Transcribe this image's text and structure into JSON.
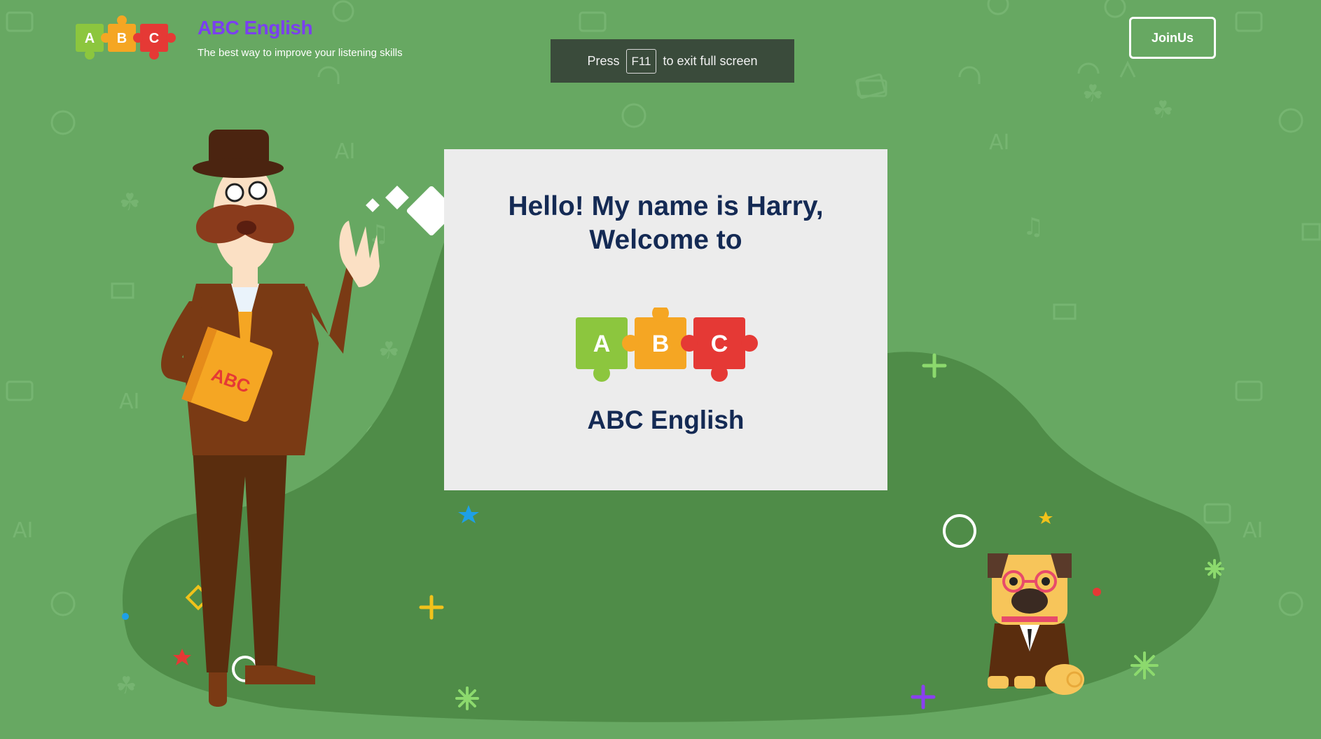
{
  "header": {
    "brand_title": "ABC English",
    "tagline": "The best way to improve your listening skills",
    "join_label": "JoinUs"
  },
  "logo": {
    "letters": [
      "A",
      "B",
      "C"
    ],
    "colors": [
      "#8cc63e",
      "#f5a623",
      "#e53935"
    ]
  },
  "fullscreen_notice": {
    "prefix": "Press",
    "key": "F11",
    "suffix": "to exit full screen"
  },
  "welcome_card": {
    "line1": "Hello! My name is Harry,",
    "line2": "Welcome to",
    "brand": "ABC English"
  },
  "character": {
    "book_text": "ABC"
  },
  "colors": {
    "background": "#67a862",
    "hill": "#4f8c48",
    "heading": "#142a54",
    "brand_title": "#7a3ff0",
    "toast": "#3a4b3b"
  }
}
